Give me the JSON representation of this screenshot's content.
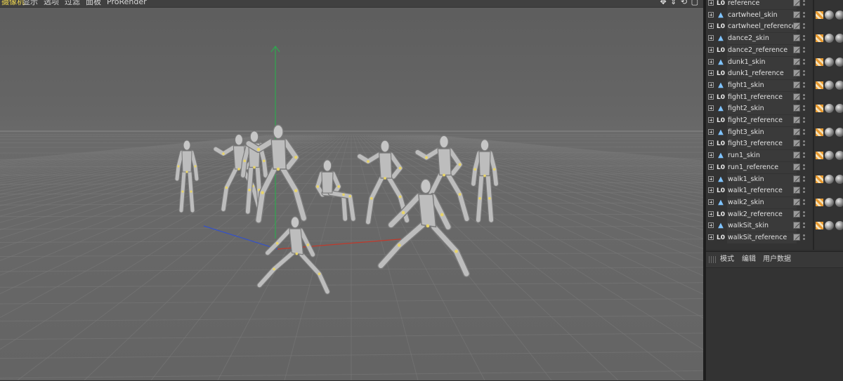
{
  "menubar": {
    "items": [
      {
        "label": "摄像机",
        "active": true
      },
      {
        "label": "显示",
        "active": false
      },
      {
        "label": "选项",
        "active": false
      },
      {
        "label": "过滤",
        "active": false
      },
      {
        "label": "面板",
        "active": false
      },
      {
        "label": "ProRender",
        "active": false
      }
    ],
    "nav_icons": "✥ ⇕ ⟲ ▢"
  },
  "viewport": {
    "background": "#666666",
    "axis_colors": {
      "x": "#c0392b",
      "y": "#2fa84f",
      "z": "#3552c8"
    }
  },
  "object_manager": {
    "rows": [
      {
        "name": "reference",
        "icon": "null-object-icon"
      },
      {
        "name": "cartwheel_skin",
        "icon": "skin-icon"
      },
      {
        "name": "cartwheel_reference",
        "icon": "null-object-icon"
      },
      {
        "name": "dance2_skin",
        "icon": "skin-icon"
      },
      {
        "name": "dance2_reference",
        "icon": "null-object-icon"
      },
      {
        "name": "dunk1_skin",
        "icon": "skin-icon"
      },
      {
        "name": "dunk1_reference",
        "icon": "null-object-icon"
      },
      {
        "name": "fight1_skin",
        "icon": "skin-icon"
      },
      {
        "name": "fight1_reference",
        "icon": "null-object-icon"
      },
      {
        "name": "fight2_skin",
        "icon": "skin-icon"
      },
      {
        "name": "fight2_reference",
        "icon": "null-object-icon"
      },
      {
        "name": "fight3_skin",
        "icon": "skin-icon"
      },
      {
        "name": "fight3_reference",
        "icon": "null-object-icon"
      },
      {
        "name": "run1_skin",
        "icon": "skin-icon"
      },
      {
        "name": "run1_reference",
        "icon": "null-object-icon"
      },
      {
        "name": "walk1_skin",
        "icon": "skin-icon"
      },
      {
        "name": "walk1_reference",
        "icon": "null-object-icon"
      },
      {
        "name": "walk2_skin",
        "icon": "skin-icon"
      },
      {
        "name": "walk2_reference",
        "icon": "null-object-icon"
      },
      {
        "name": "walkSit_skin",
        "icon": "skin-icon"
      },
      {
        "name": "walkSit_reference",
        "icon": "null-object-icon"
      }
    ]
  },
  "attribute_manager": {
    "tabs": [
      "模式",
      "编辑",
      "用户数据"
    ]
  }
}
